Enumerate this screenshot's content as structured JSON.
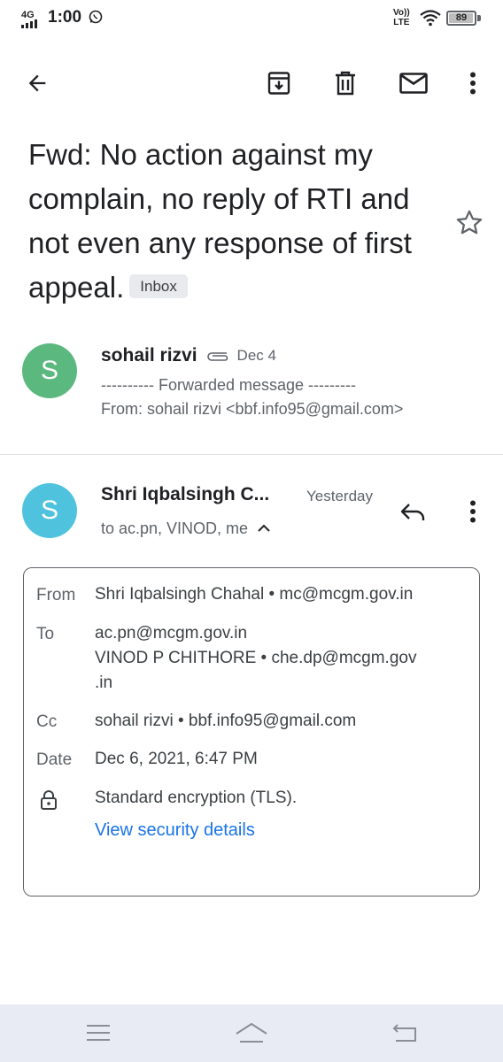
{
  "status_bar": {
    "network": "4G",
    "time": "1:00",
    "volte_top": "Vo))",
    "volte_bottom": "LTE",
    "battery": "89",
    "battery_level": 0.89
  },
  "toolbar": {
    "icons": [
      "back-arrow-icon",
      "archive-icon",
      "delete-icon",
      "mark-unread-icon",
      "more-vert-icon"
    ]
  },
  "subject": {
    "text": "Fwd: No action against my complain, no reply of RTI and not even any response of first appeal.",
    "label_chip": "Inbox"
  },
  "message1": {
    "avatar_letter": "S",
    "avatar_color": "#5bb87f",
    "sender": "sohail rizvi",
    "date": "Dec 4",
    "snippet_line1": "---------- Forwarded message ---------",
    "snippet_line2": "From: sohail rizvi <bbf.info95@gmail.com>"
  },
  "message2": {
    "avatar_letter": "S",
    "avatar_color": "#4fc3dd",
    "sender": "Shri Iqbalsingh C...",
    "date": "Yesterday",
    "recipients": "to ac.pn, VINOD, me"
  },
  "details": {
    "from_label": "From",
    "from_value": "Shri Iqbalsingh Chahal • mc@mcgm.gov.in",
    "to_label": "To",
    "to_line1": "ac.pn@mcgm.gov.in",
    "to_line2": "VINOD P CHITHORE • che.dp@mcgm.gov",
    "to_line3": ".in",
    "cc_label": "Cc",
    "cc_value": "sohail rizvi • bbf.info95@gmail.com",
    "date_label": "Date",
    "date_value": "Dec 6, 2021, 6:47 PM",
    "encryption": "Standard encryption (TLS).",
    "security_link": "View security details"
  },
  "colors": {
    "link": "#1a73e8",
    "nav_bar": "#e8eaf4"
  }
}
